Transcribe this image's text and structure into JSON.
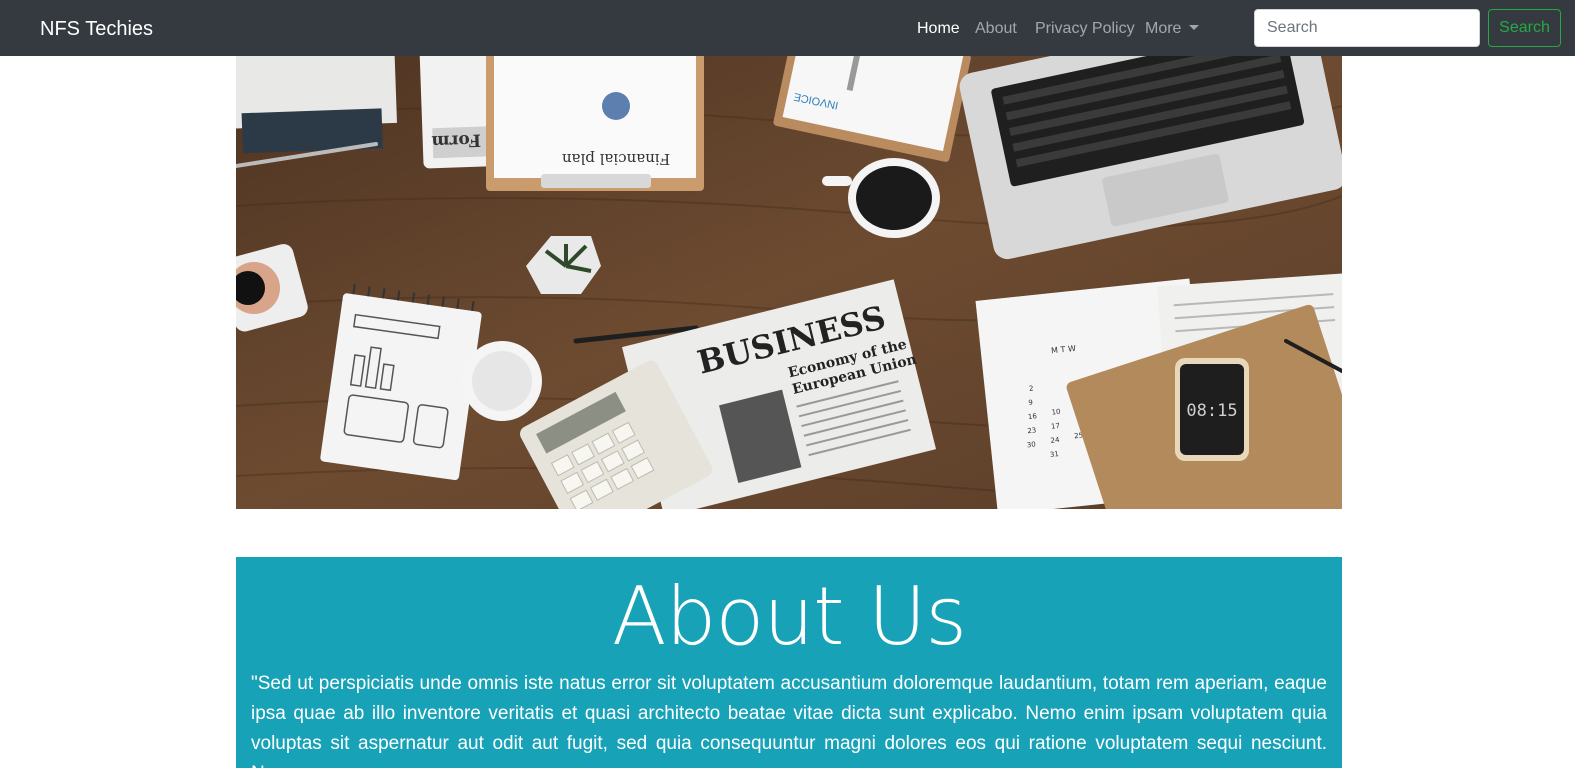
{
  "navbar": {
    "brand": "NFS Techies",
    "links": [
      {
        "label": "Home",
        "active": true
      },
      {
        "label": "About",
        "active": false
      },
      {
        "label": "Privacy Policy",
        "active": false
      },
      {
        "label": "More",
        "active": false,
        "dropdown": true
      }
    ],
    "search": {
      "placeholder": "Search",
      "button_label": "Search"
    }
  },
  "hero": {
    "tax_form": "Tax Refund Form",
    "financial_plan": "Financial plan",
    "invoice": "INVOICE",
    "newspaper_head": "BUSINESS",
    "newspaper_sub1": "Economy of the",
    "newspaper_sub2": "European Union",
    "phone_time": "08:15",
    "calendar_header": "M T W",
    "calendar_nums": [
      "2",
      "9",
      "16",
      "23",
      "30",
      "10",
      "17",
      "24",
      "31",
      "25"
    ]
  },
  "about": {
    "title": "About Us",
    "text": "\"Sed ut perspiciatis unde omnis iste natus error sit voluptatem accusantium doloremque laudantium, totam rem aperiam, eaque ipsa quae ab illo inventore veritatis et quasi architecto beatae vitae dicta sunt explicabo. Nemo enim ipsam voluptatem quia voluptas sit aspernatur aut odit aut fugit, sed quia consequuntur magni dolores eos qui ratione voluptatem sequi nesciunt. Neque"
  },
  "colors": {
    "navbar_bg": "#343a40",
    "accent_success": "#28a745",
    "about_bg": "#17a2b8",
    "wood": "#6b4a30"
  }
}
